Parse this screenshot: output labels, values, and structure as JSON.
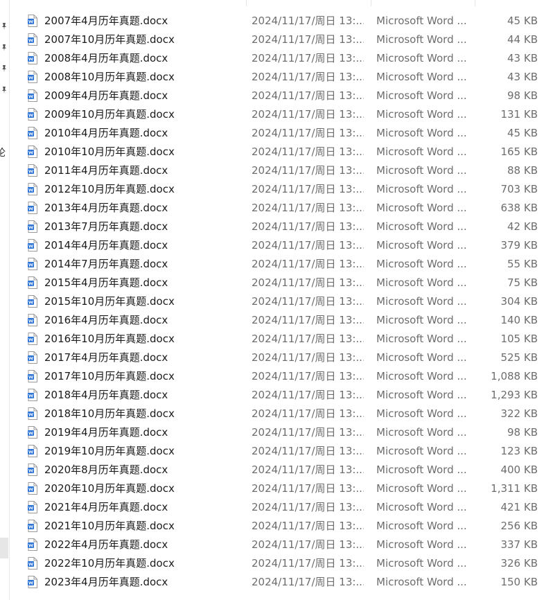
{
  "nav_pane": {
    "partial_text": "论"
  },
  "files": [
    {
      "name": "2007年4月历年真题.docx",
      "modified": "2024/11/17/周日 13:...",
      "type": "Microsoft Word ...",
      "size": "45 KB"
    },
    {
      "name": "2007年10月历年真题.docx",
      "modified": "2024/11/17/周日 13:...",
      "type": "Microsoft Word ...",
      "size": "44 KB"
    },
    {
      "name": "2008年4月历年真题.docx",
      "modified": "2024/11/17/周日 13:...",
      "type": "Microsoft Word ...",
      "size": "43 KB"
    },
    {
      "name": "2008年10月历年真题.docx",
      "modified": "2024/11/17/周日 13:...",
      "type": "Microsoft Word ...",
      "size": "43 KB"
    },
    {
      "name": "2009年4月历年真题.docx",
      "modified": "2024/11/17/周日 13:...",
      "type": "Microsoft Word ...",
      "size": "98 KB"
    },
    {
      "name": "2009年10月历年真题.docx",
      "modified": "2024/11/17/周日 13:...",
      "type": "Microsoft Word ...",
      "size": "131 KB"
    },
    {
      "name": "2010年4月历年真题.docx",
      "modified": "2024/11/17/周日 13:...",
      "type": "Microsoft Word ...",
      "size": "45 KB"
    },
    {
      "name": "2010年10月历年真题.docx",
      "modified": "2024/11/17/周日 13:...",
      "type": "Microsoft Word ...",
      "size": "165 KB"
    },
    {
      "name": "2011年4月历年真题.docx",
      "modified": "2024/11/17/周日 13:...",
      "type": "Microsoft Word ...",
      "size": "88 KB"
    },
    {
      "name": "2012年10月历年真题.docx",
      "modified": "2024/11/17/周日 13:...",
      "type": "Microsoft Word ...",
      "size": "703 KB"
    },
    {
      "name": "2013年4月历年真题.docx",
      "modified": "2024/11/17/周日 13:...",
      "type": "Microsoft Word ...",
      "size": "638 KB"
    },
    {
      "name": "2013年7月历年真题.docx",
      "modified": "2024/11/17/周日 13:...",
      "type": "Microsoft Word ...",
      "size": "42 KB"
    },
    {
      "name": "2014年4月历年真题.docx",
      "modified": "2024/11/17/周日 13:...",
      "type": "Microsoft Word ...",
      "size": "379 KB"
    },
    {
      "name": "2014年7月历年真题.docx",
      "modified": "2024/11/17/周日 13:...",
      "type": "Microsoft Word ...",
      "size": "55 KB"
    },
    {
      "name": "2015年4月历年真题.docx",
      "modified": "2024/11/17/周日 13:...",
      "type": "Microsoft Word ...",
      "size": "75 KB"
    },
    {
      "name": "2015年10月历年真题.docx",
      "modified": "2024/11/17/周日 13:...",
      "type": "Microsoft Word ...",
      "size": "304 KB"
    },
    {
      "name": "2016年4月历年真题.docx",
      "modified": "2024/11/17/周日 13:...",
      "type": "Microsoft Word ...",
      "size": "140 KB"
    },
    {
      "name": "2016年10月历年真题.docx",
      "modified": "2024/11/17/周日 13:...",
      "type": "Microsoft Word ...",
      "size": "105 KB"
    },
    {
      "name": "2017年4月历年真题.docx",
      "modified": "2024/11/17/周日 13:...",
      "type": "Microsoft Word ...",
      "size": "525 KB"
    },
    {
      "name": "2017年10月历年真题.docx",
      "modified": "2024/11/17/周日 13:...",
      "type": "Microsoft Word ...",
      "size": "1,088 KB"
    },
    {
      "name": "2018年4月历年真题.docx",
      "modified": "2024/11/17/周日 13:...",
      "type": "Microsoft Word ...",
      "size": "1,293 KB"
    },
    {
      "name": "2018年10月历年真题.docx",
      "modified": "2024/11/17/周日 13:...",
      "type": "Microsoft Word ...",
      "size": "322 KB"
    },
    {
      "name": "2019年4月历年真题.docx",
      "modified": "2024/11/17/周日 13:...",
      "type": "Microsoft Word ...",
      "size": "98 KB"
    },
    {
      "name": "2019年10月历年真题.docx",
      "modified": "2024/11/17/周日 13:...",
      "type": "Microsoft Word ...",
      "size": "123 KB"
    },
    {
      "name": "2020年8月历年真题.docx",
      "modified": "2024/11/17/周日 13:...",
      "type": "Microsoft Word ...",
      "size": "400 KB"
    },
    {
      "name": "2020年10月历年真题.docx",
      "modified": "2024/11/17/周日 13:...",
      "type": "Microsoft Word ...",
      "size": "1,311 KB"
    },
    {
      "name": "2021年4月历年真题.docx",
      "modified": "2024/11/17/周日 13:...",
      "type": "Microsoft Word ...",
      "size": "421 KB"
    },
    {
      "name": "2021年10月历年真题.docx",
      "modified": "2024/11/17/周日 13:...",
      "type": "Microsoft Word ...",
      "size": "256 KB"
    },
    {
      "name": "2022年4月历年真题.docx",
      "modified": "2024/11/17/周日 13:...",
      "type": "Microsoft Word ...",
      "size": "337 KB"
    },
    {
      "name": "2022年10月历年真题.docx",
      "modified": "2024/11/17/周日 13:...",
      "type": "Microsoft Word ...",
      "size": "326 KB"
    },
    {
      "name": "2023年4月历年真题.docx",
      "modified": "2024/11/17/周日 13:...",
      "type": "Microsoft Word ...",
      "size": "150 KB"
    }
  ],
  "icons": {
    "pin": "pin-icon",
    "file": "word-document-icon"
  },
  "colors": {
    "word_blue": "#2b73d6",
    "secondary_text": "#6d6d6d"
  }
}
